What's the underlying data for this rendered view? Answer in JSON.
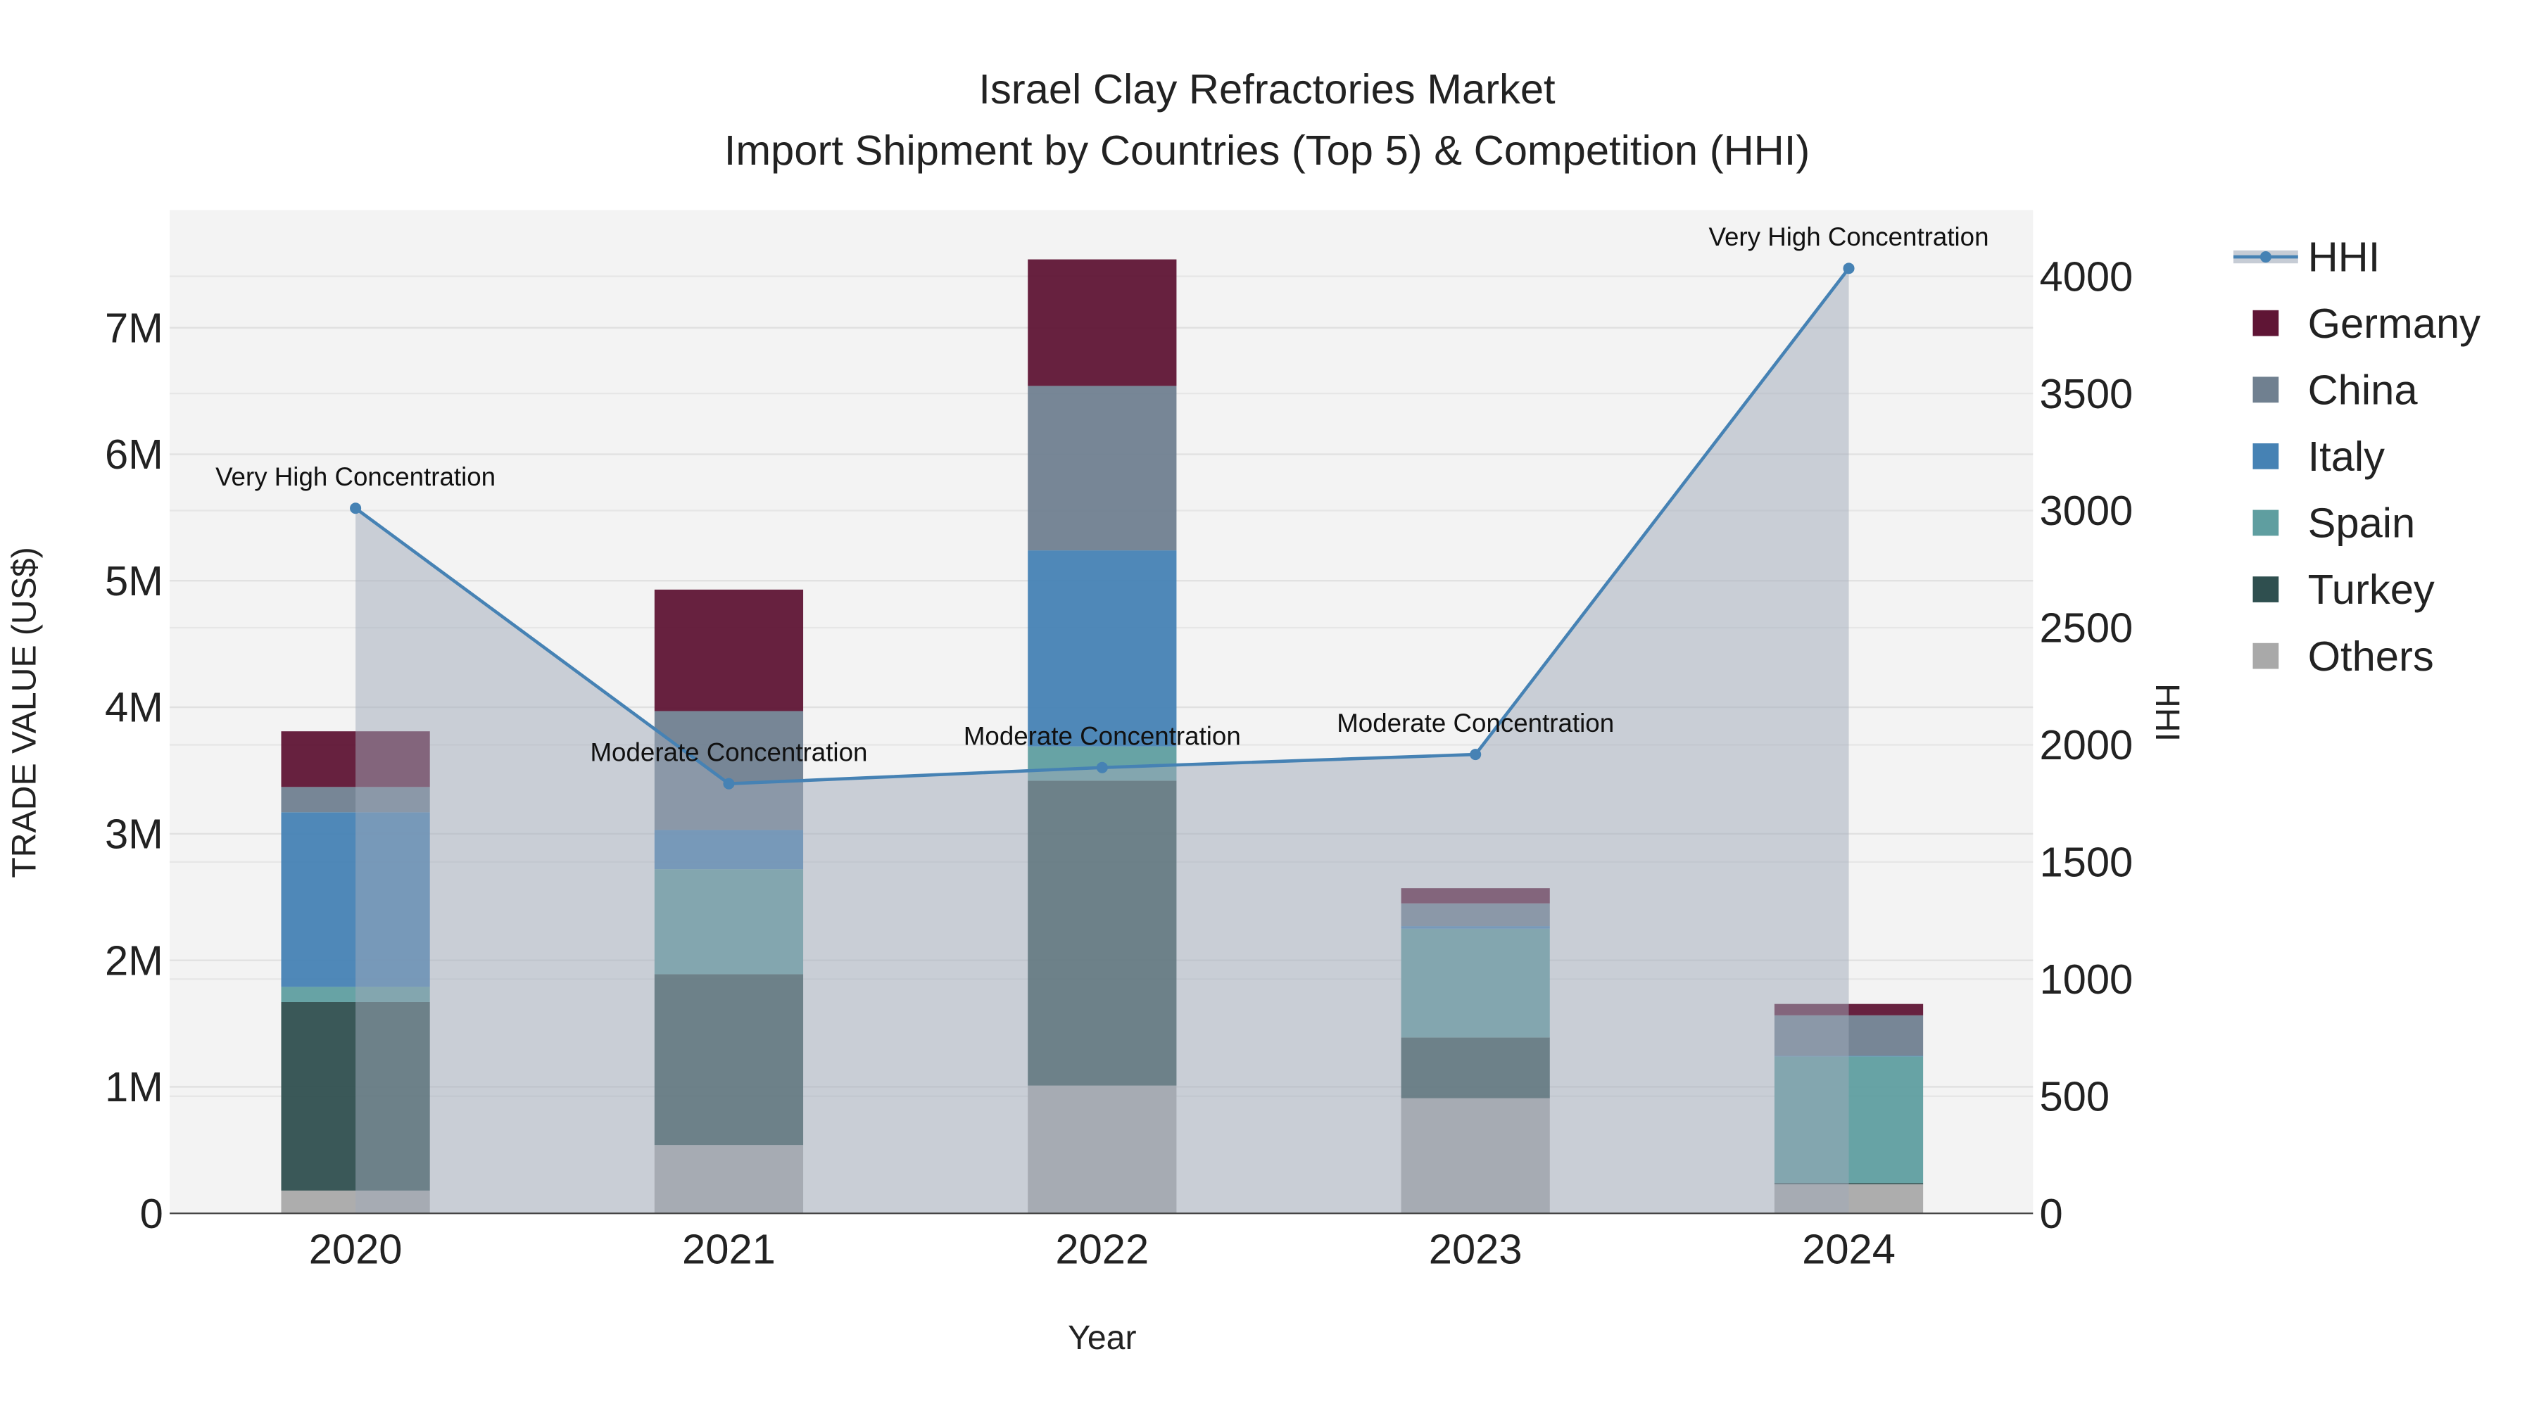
{
  "chart_data": {
    "type": "bar",
    "stacked": true,
    "title": "Israel Clay Refractories Market",
    "subtitle": "Import Shipment by Countries (Top 5) & Competition (HHI)",
    "xlabel": "Year",
    "ylabel": "TRADE VALUE (US$)",
    "y2label": "HHI",
    "categories": [
      "2020",
      "2021",
      "2022",
      "2023",
      "2024"
    ],
    "ylim": [
      0,
      7930000
    ],
    "y2lim": [
      0,
      4283
    ],
    "yticks": [
      0,
      1000000,
      2000000,
      3000000,
      4000000,
      5000000,
      6000000,
      7000000
    ],
    "ytick_labels": [
      "0",
      "1M",
      "2M",
      "3M",
      "4M",
      "5M",
      "6M",
      "7M"
    ],
    "y2ticks": [
      0,
      500,
      1000,
      1500,
      2000,
      2500,
      3000,
      3500,
      4000
    ],
    "y2tick_labels": [
      "0",
      "500",
      "1000",
      "1500",
      "2000",
      "2500",
      "3000",
      "3500",
      "4000"
    ],
    "series": [
      {
        "name": "Others",
        "color": "#a9a9a9",
        "values": [
          180000,
          540000,
          1010000,
          910000,
          230000
        ]
      },
      {
        "name": "Turkey",
        "color": "#2f4f4f",
        "values": [
          1490000,
          1350000,
          2410000,
          480000,
          10000
        ]
      },
      {
        "name": "Spain",
        "color": "#5f9ea0",
        "values": [
          120000,
          830000,
          270000,
          860000,
          1000000
        ]
      },
      {
        "name": "Italy",
        "color": "#4682b4",
        "values": [
          1380000,
          310000,
          1550000,
          20000,
          5000
        ]
      },
      {
        "name": "China",
        "color": "#708090",
        "values": [
          200000,
          940000,
          1300000,
          180000,
          320000
        ]
      },
      {
        "name": "Germany",
        "color": "#5f1535",
        "values": [
          440000,
          960000,
          1000000,
          120000,
          90000
        ]
      }
    ],
    "hhi": {
      "name": "HHI",
      "color": "#4682b4",
      "values": [
        3010,
        1834,
        1903,
        1959,
        4034
      ],
      "annotations": [
        "Very High Concentration",
        "Moderate Concentration",
        "Moderate Concentration",
        "Moderate Concentration",
        "Very High Concentration"
      ]
    },
    "legend": {
      "placement": "right",
      "order": [
        "HHI",
        "Germany",
        "China",
        "Italy",
        "Spain",
        "Turkey",
        "Others"
      ]
    },
    "grid": true
  }
}
